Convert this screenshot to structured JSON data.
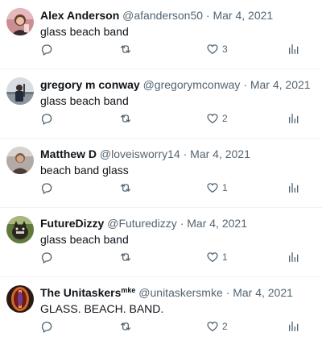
{
  "tweets": [
    {
      "name": "Alex Anderson",
      "name_sup": "",
      "handle": "@afanderson50",
      "separator": "·",
      "date": "Mar 4, 2021",
      "text": "glass beach band",
      "likes": "3",
      "avatar": "avatar-photo-alex"
    },
    {
      "name": "gregory m conway",
      "name_sup": "",
      "handle": "@gregorymconway",
      "separator": "·",
      "date": "Mar 4, 2021",
      "text": "glass beach band",
      "likes": "2",
      "avatar": "avatar-photo-gregory"
    },
    {
      "name": "Matthew D",
      "name_sup": "",
      "handle": "@loveisworry14",
      "separator": "·",
      "date": "Mar 4, 2021",
      "text": "beach band glass",
      "likes": "1",
      "avatar": "avatar-photo-matthew"
    },
    {
      "name": "FutureDizzy",
      "name_sup": "",
      "handle": "@Futuredizzy",
      "separator": "·",
      "date": "Mar 4, 2021",
      "text": "glass beach band",
      "likes": "1",
      "avatar": "avatar-photo-futuredizzy"
    },
    {
      "name": "The Unitaskers",
      "name_sup": "mke",
      "handle": "@unitaskersmke",
      "separator": "·",
      "date": "Mar 4, 2021",
      "text": "GLASS. BEACH. BAND.",
      "likes": "2",
      "avatar": "avatar-logo-unitaskers"
    }
  ],
  "colors": {
    "text_primary": "#0f1419",
    "text_secondary": "#536471",
    "divider": "#eff3f4"
  },
  "icons": [
    "reply-icon",
    "retweet-icon",
    "like-icon",
    "views-icon"
  ]
}
